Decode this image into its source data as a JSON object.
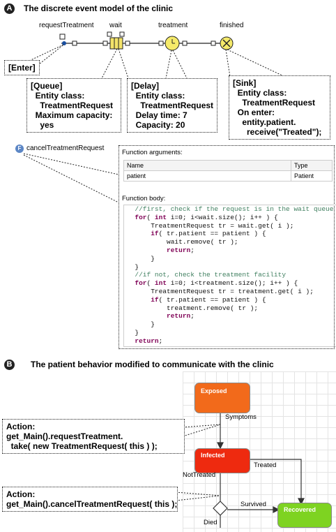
{
  "section_a": {
    "badge": "A",
    "title": "The discrete event model of the clinic",
    "blocks": {
      "request_treatment": "requestTreatment",
      "wait": "wait",
      "treatment": "treatment",
      "finished": "finished"
    },
    "enter_callout": "[Enter]",
    "queue_callout": "[Queue]\n  Entity class:\n    TreatmentRequest\n  Maximum capacity:\n    yes",
    "delay_callout": "[Delay]\n  Entity class:\n    TreatmentRequest\n  Delay time: 7\n  Capacity: 20",
    "sink_callout": "[Sink]\n  Entity class:\n    TreatmentRequest\n  On enter:\n    entity.patient.\n      receive(\"Treated\");",
    "function": {
      "icon_letter": "F",
      "name": "cancelTreatmentRequest",
      "args_label": "Function arguments:",
      "col_name": "Name",
      "col_type": "Type",
      "arg_name": "patient",
      "arg_type": "Patient",
      "body_label": "Function body:"
    }
  },
  "section_b": {
    "badge": "B",
    "title": "The patient behavior modified to communicate with the clinic",
    "states": {
      "exposed": "Exposed",
      "infected": "Infected",
      "recovered": "Recovered"
    },
    "transitions": {
      "symptoms": "Symptoms",
      "treated": "Treated",
      "not_treated": "NotTreated",
      "survived": "Survived",
      "died": "Died"
    },
    "action1": "Action:\nget_Main().requestTreatment.\n  take( new TreatmentRequest( this ) );",
    "action2": "Action:\nget_Main().cancelTreatmentRequest( this );"
  },
  "colors": {
    "exposed": "#f26a1b",
    "infected": "#ee2a0f",
    "recovered": "#7ed321",
    "delay": "#f5ea6a"
  }
}
